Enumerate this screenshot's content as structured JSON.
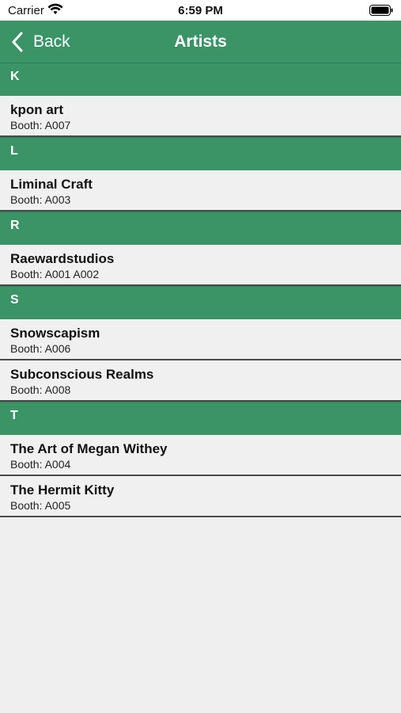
{
  "status_bar": {
    "carrier": "Carrier",
    "time": "6:59 PM"
  },
  "nav": {
    "back_label": "Back",
    "title": "Artists",
    "color": "#3a9466"
  },
  "sections": [
    {
      "letter": "K",
      "items": [
        {
          "name": "kpon art",
          "booth": "Booth: A007"
        }
      ]
    },
    {
      "letter": "L",
      "items": [
        {
          "name": "Liminal Craft",
          "booth": "Booth: A003"
        }
      ]
    },
    {
      "letter": "R",
      "items": [
        {
          "name": "Raewardstudios",
          "booth": "Booth: A001 A002"
        }
      ]
    },
    {
      "letter": "S",
      "items": [
        {
          "name": "Snowscapism",
          "booth": "Booth: A006"
        },
        {
          "name": "Subconscious Realms",
          "booth": "Booth: A008"
        }
      ]
    },
    {
      "letter": "T",
      "items": [
        {
          "name": "The Art of Megan Withey",
          "booth": "Booth: A004"
        },
        {
          "name": "The Hermit Kitty",
          "booth": "Booth: A005"
        }
      ]
    }
  ]
}
